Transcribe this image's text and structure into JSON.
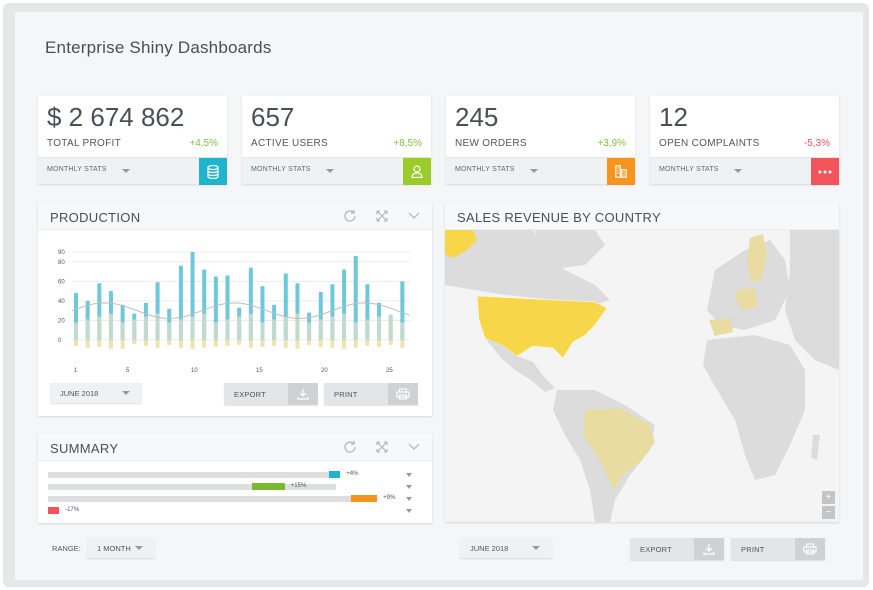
{
  "app": {
    "title": "Enterprise Shiny Dashboards"
  },
  "kpis": [
    {
      "value": "$ 2 674 862",
      "label": "TOTAL PROFIT",
      "change": "+4,5%",
      "change_color": "#7cc242",
      "stats_label": "MONTHLY STATS",
      "icon": "database-icon",
      "icon_color": "#1fb3cc"
    },
    {
      "value": "657",
      "label": "ACTIVE USERS",
      "change": "+8,5%",
      "change_color": "#7cc242",
      "stats_label": "MONTHLY STATS",
      "icon": "user-icon",
      "icon_color": "#9ccb2c"
    },
    {
      "value": "245",
      "label": "NEW ORDERS",
      "change": "+3,9%",
      "change_color": "#7cc242",
      "stats_label": "MONTHLY STATS",
      "icon": "buildings-icon",
      "icon_color": "#f7941d"
    },
    {
      "value": "12",
      "label": "OPEN COMPLAINTS",
      "change": "-5,3%",
      "change_color": "#f2545b",
      "stats_label": "MONTHLY STATS",
      "icon": "more-dots-icon",
      "icon_color": "#f2545b"
    }
  ],
  "production": {
    "title": "PRODUCTION",
    "period": "JUNE 2018",
    "export_label": "EXPORT",
    "print_label": "PRINT"
  },
  "summary": {
    "title": "SUMMARY",
    "rows": [
      {
        "value": 4,
        "pct": "+4%",
        "color": "#1fb3cc",
        "fill_start": 0.76,
        "fill_end": 0.79
      },
      {
        "value": 15,
        "pct": "+15%",
        "color": "#7cb82f",
        "fill_start": 0.55,
        "fill_end": 0.64
      },
      {
        "value": 9,
        "pct": "+9%",
        "color": "#f7941d",
        "fill_start": 0.82,
        "fill_end": 0.89
      },
      {
        "value": -17,
        "pct": "-17%",
        "color": "#f2545b",
        "fill_start": 0.0,
        "fill_end": 0.03
      }
    ],
    "range_label": "RANGE:",
    "range_value": "1 MONTH"
  },
  "sales": {
    "title": "SALES REVENUE BY COUNTRY",
    "period": "JUNE 2018",
    "export_label": "EXPORT",
    "print_label": "PRINT",
    "zoom_in": "+",
    "zoom_out": "−",
    "highlight_color": "#f7d64a",
    "secondary_color": "#e8dca0"
  },
  "chart_data": {
    "type": "bar",
    "x": [
      1,
      2,
      3,
      4,
      5,
      6,
      7,
      8,
      9,
      10,
      11,
      12,
      13,
      14,
      15,
      16,
      17,
      18,
      19,
      20,
      21,
      22,
      23,
      24,
      25,
      26
    ],
    "x_ticks": [
      "1",
      "5",
      "10",
      "15",
      "20",
      "25"
    ],
    "y_ticks": [
      "90",
      "80",
      "60",
      "40",
      "20",
      "0"
    ],
    "ylim": [
      -10,
      90
    ],
    "series": [
      {
        "color": "#6ec8dc",
        "values": [
          48,
          40,
          58,
          50,
          36,
          27,
          38,
          59,
          32,
          76,
          90,
          72,
          65,
          66,
          33,
          74,
          55,
          36,
          68,
          58,
          28,
          49,
          57,
          72,
          86,
          57,
          38,
          26,
          60
        ]
      },
      {
        "color": "#efe2b0",
        "values": [
          -6,
          -8,
          -7,
          -9,
          -9,
          -4,
          -6,
          -8,
          -5,
          -8,
          -9,
          -8,
          -7,
          -6,
          -5,
          -8,
          -7,
          -6,
          -8,
          -9,
          -5,
          -7,
          -8,
          -9,
          -8,
          -6,
          -7,
          -5,
          -8
        ]
      }
    ]
  }
}
